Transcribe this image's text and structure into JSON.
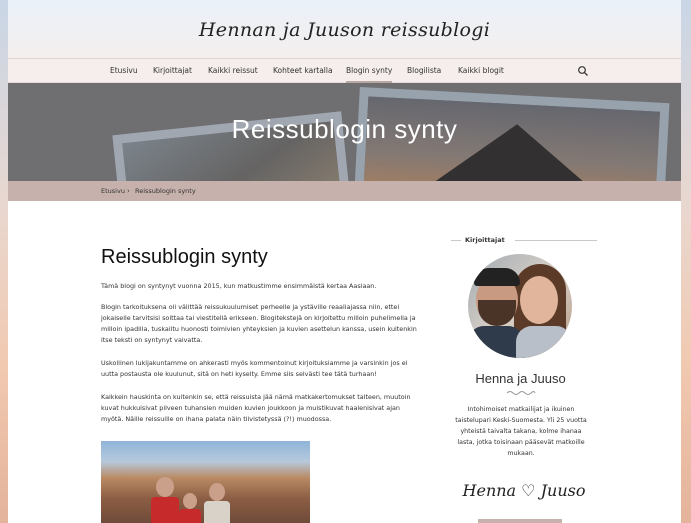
{
  "site": {
    "title": "Hennan ja Juuson reissublogi"
  },
  "nav": {
    "items": [
      {
        "label": "Etusivu"
      },
      {
        "label": "Kirjoittajat"
      },
      {
        "label": "Kaikki reissut"
      },
      {
        "label": "Kohteet kartalla"
      },
      {
        "label": "Blogin synty"
      },
      {
        "label": "Blogilista"
      },
      {
        "label": "Kaikki blogit"
      }
    ],
    "active": "Blogin synty",
    "search_icon": "search-icon"
  },
  "hero": {
    "title": "Reissublogin synty"
  },
  "breadcrumb": {
    "home": "Etusivu",
    "separator": "›",
    "current": "Reissublogin synty"
  },
  "post": {
    "title": "Reissublogin synty",
    "paragraphs": [
      "Tämä blogi on syntynyt vuonna 2015, kun matkustimme ensimmäistä kertaa Aasiaan.",
      "Blogin tarkoituksena oli välittää reissukuulumiset perheelle ja ystäville reaaliajassa niin, ettei jokaiselle tarvitsisi soittaa tai viestitellä erikseen. Blogitekstejä on kirjoitettu milloin puhelimella ja milloin ipadilla, tuskailtu huonosti toimivien yhteyksien ja kuvien asettelun kanssa, usein kuitenkin itse teksti on syntynyt vaivatta.",
      "Uskollinen lukijakuntamme on ahkerasti myös kommentoinut kirjoituksiamme ja varsinkin jos ei uutta postausta ole kuulunut, sitä on heti kyselty. Emme siis selvästi tee tätä turhaan!",
      "Kaikkein hauskinta on kuitenkin se, että reissuista jää nämä matkakertomukset talteen, muutoin kuvat hukkuisivat pilveen tuhansien muiden kuvien joukkoon ja muistikuvat haalenisivat ajan myötä. Näille reissuille on ihana palata näin tiivistetyssä (?!) muodossa."
    ]
  },
  "sidebar": {
    "widget_title": "Kirjoittajat",
    "author_name": "Henna ja Juuso",
    "bio": "Intohimoiset matkailijat ja ikuinen taistelupari Keski-Suomesta. Yli 25 vuotta yhteistä taivalta takana, kolme ihanaa lasta, jotka toisinaan pääsevät matkoille mukaan.",
    "signature": "Henna ♡ Juuso"
  },
  "colors": {
    "accent": "#c6b1ac",
    "hero_bg": "#7b7b7d",
    "text": "#333333"
  }
}
